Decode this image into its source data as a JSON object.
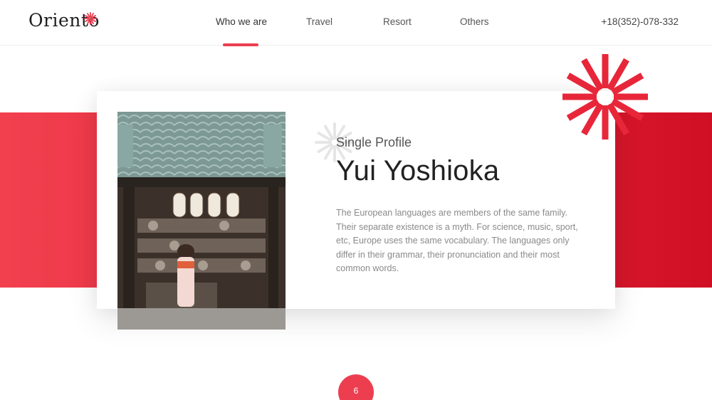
{
  "brand": {
    "name": "Oriento",
    "accent": "#ec3e4f"
  },
  "nav": {
    "items": [
      {
        "label": "Who we are",
        "active": true
      },
      {
        "label": "Travel"
      },
      {
        "label": "Resort"
      },
      {
        "label": "Others"
      }
    ]
  },
  "phone": "+18(352)-078-332",
  "profile": {
    "subtitle": "Single Profile",
    "name": "Yui Yoshioka",
    "description": "The European languages are members of the same family. Their separate existence is a myth. For science, music, sport, etc, Europe uses the same vocabulary. The languages only differ in their grammar, their pronunciation and their most common words."
  },
  "page_number": "6",
  "icons": {
    "logo_mark": "sunburst-icon",
    "decor": "sunburst-icon"
  }
}
